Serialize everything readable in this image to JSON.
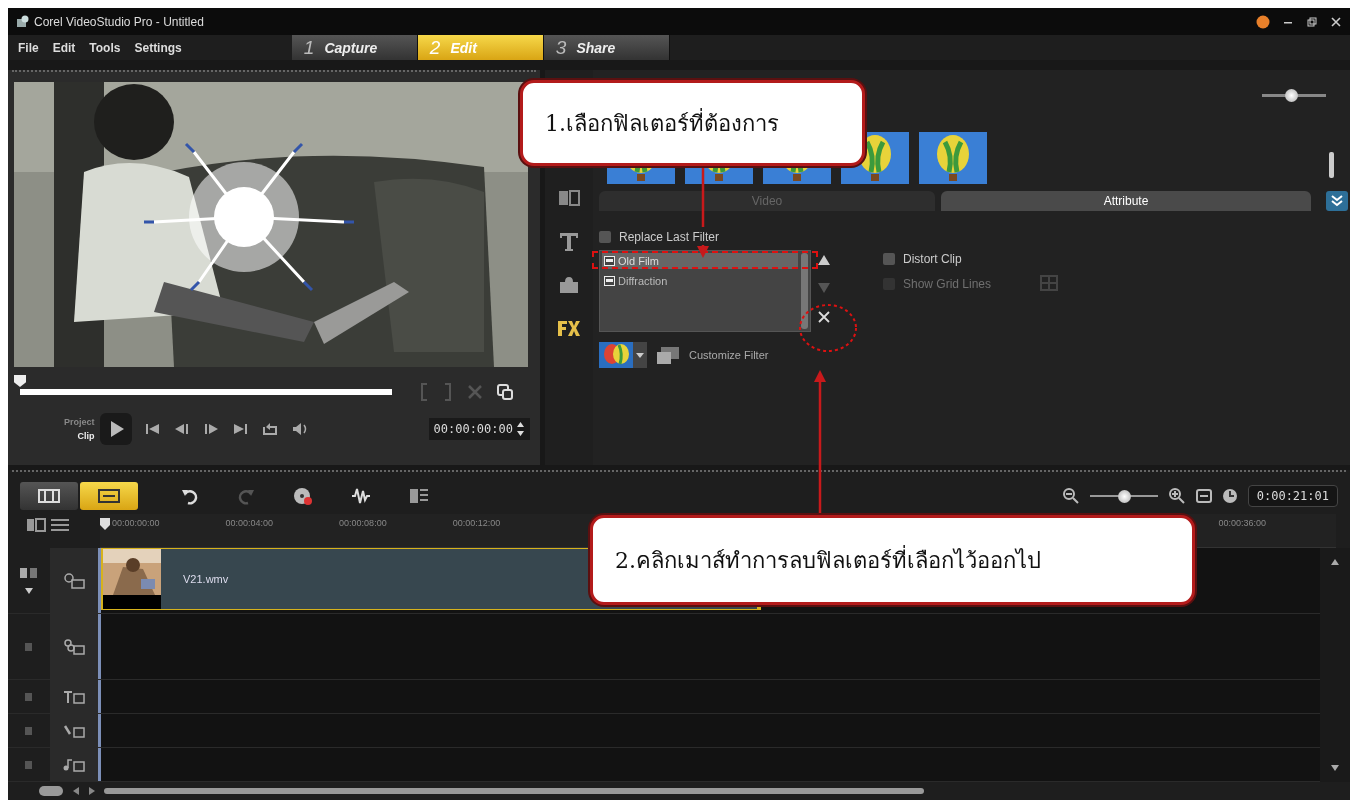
{
  "window": {
    "title": "Corel VideoStudio Pro - Untitled"
  },
  "menu": [
    "File",
    "Edit",
    "Tools",
    "Settings"
  ],
  "steps": [
    {
      "number": "1",
      "label": "Capture",
      "selected": false
    },
    {
      "number": "2",
      "label": "Edit",
      "selected": true
    },
    {
      "number": "3",
      "label": "Share",
      "selected": false
    }
  ],
  "preview": {
    "scrubber": {
      "level": 0
    },
    "project_label": "Project",
    "clip_label": "Clip",
    "timecode": "00:00:00:00"
  },
  "library": {
    "size_slider": {
      "level": 0.45
    },
    "tabs": [
      {
        "label": "Video",
        "selected": false
      },
      {
        "label": "Attribute",
        "selected": true
      }
    ]
  },
  "attribute": {
    "replace_last_filter": {
      "label": "Replace Last Filter",
      "checked": false
    },
    "filters": [
      {
        "label": "Old Film",
        "selected": true
      },
      {
        "label": "Diffraction",
        "selected": false
      }
    ],
    "options": [
      {
        "label": "Distort Clip",
        "checked": false,
        "disabled": false
      },
      {
        "label": "Show Grid Lines",
        "checked": false,
        "disabled": true
      }
    ],
    "customize": "Customize Filter"
  },
  "timeline": {
    "zoom": {
      "level": 0.5
    },
    "duration": "0:00:21:01",
    "ruler": [
      "00:00:00:00",
      "00:00:04:00",
      "00:00:08:00",
      "00:00:12:00"
    ],
    "ruler_end": "00:00:36:00",
    "tracks": [
      {
        "kind": "video",
        "clip": "V21.wmv"
      },
      {
        "kind": "overlay"
      },
      {
        "kind": "title"
      },
      {
        "kind": "voice"
      },
      {
        "kind": "music"
      }
    ]
  },
  "callouts": [
    {
      "text": "1.เลือกฟิลเตอร์ที่ต้องการ"
    },
    {
      "text": "2.คลิกเมาส์ทำการลบฟิลเตอร์ที่เลือกไว้ออกไป"
    }
  ]
}
